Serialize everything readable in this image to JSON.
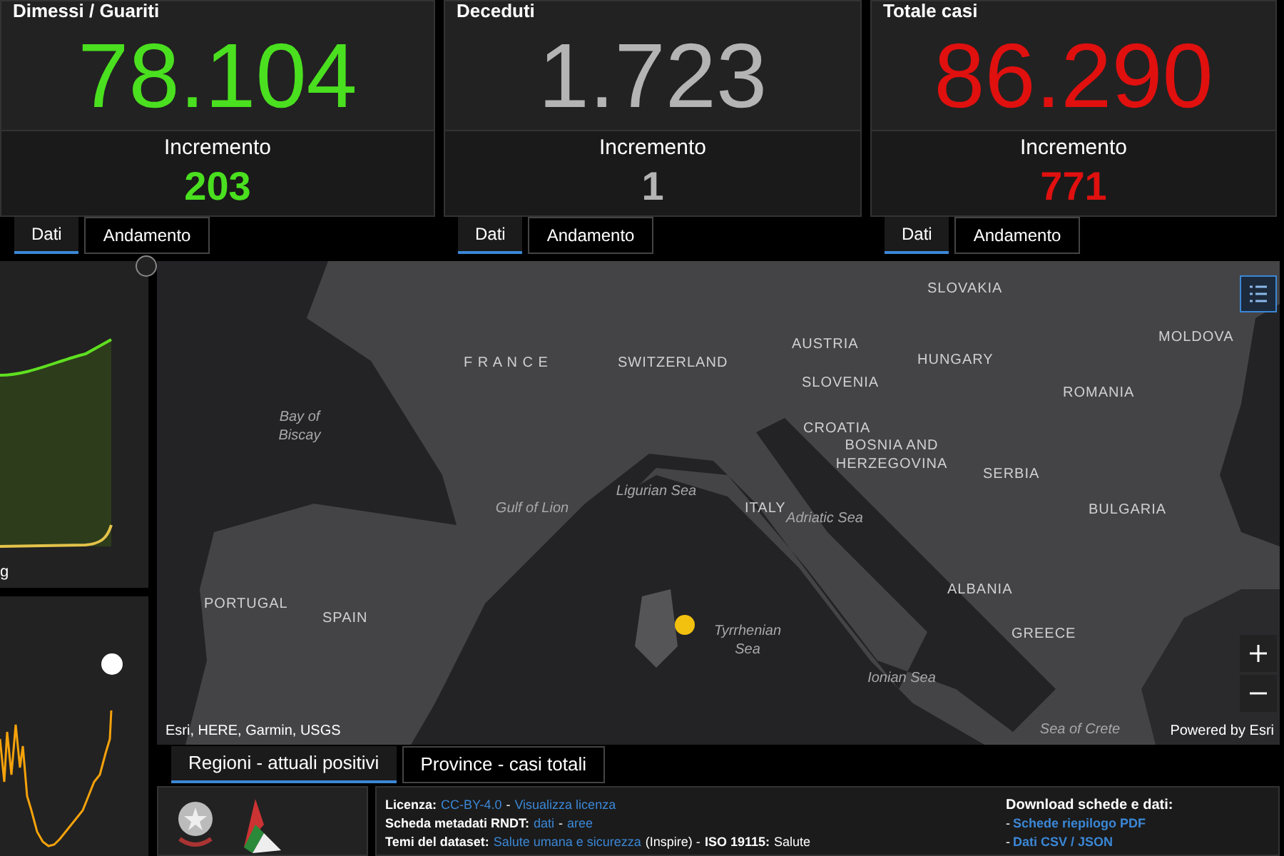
{
  "stats": [
    {
      "title": "Dimessi / Guariti",
      "value": "78.104",
      "increment_label": "Incremento",
      "increment": "203",
      "color": "#4ae01f",
      "tabs": [
        {
          "label": "Dati",
          "selected": true
        },
        {
          "label": "Andamento",
          "selected": false
        }
      ]
    },
    {
      "title": "Deceduti",
      "value": "1.723",
      "increment_label": "Incremento",
      "increment": "1",
      "color": "#b4b4b4",
      "tabs": [
        {
          "label": "Dati",
          "selected": true
        },
        {
          "label": "Andamento",
          "selected": false
        }
      ]
    },
    {
      "title": "Totale casi",
      "value": "86.290",
      "increment_label": "Incremento",
      "increment": "771",
      "color": "#e0100f",
      "tabs": [
        {
          "label": "Dati",
          "selected": true
        },
        {
          "label": "Andamento",
          "selected": false
        }
      ]
    }
  ],
  "trend_panel": {
    "axis_label": "g"
  },
  "map": {
    "labels": [
      {
        "text": "SLOVAKIA",
        "kind": "country"
      },
      {
        "text": "MOLDOVA",
        "kind": "country"
      },
      {
        "text": "F R A N C E",
        "kind": "country"
      },
      {
        "text": "SWITZERLAND",
        "kind": "country"
      },
      {
        "text": "AUSTRIA",
        "kind": "country"
      },
      {
        "text": "HUNGARY",
        "kind": "country"
      },
      {
        "text": "SLOVENIA",
        "kind": "country"
      },
      {
        "text": "ROMANIA",
        "kind": "country"
      },
      {
        "text": "Bay of Biscay",
        "kind": "sea"
      },
      {
        "text": "CROATIA",
        "kind": "country"
      },
      {
        "text": "BOSNIA AND HERZEGOVINA",
        "kind": "country"
      },
      {
        "text": "SERBIA",
        "kind": "country"
      },
      {
        "text": "Ligurian Sea",
        "kind": "sea"
      },
      {
        "text": "Gulf of Lion",
        "kind": "sea"
      },
      {
        "text": "ITALY",
        "kind": "country"
      },
      {
        "text": "Adriatic Sea",
        "kind": "sea"
      },
      {
        "text": "BULGARIA",
        "kind": "country"
      },
      {
        "text": "ALBANIA",
        "kind": "country"
      },
      {
        "text": "PORTUGAL",
        "kind": "country"
      },
      {
        "text": "SPAIN",
        "kind": "country"
      },
      {
        "text": "Tyrrhenian Sea",
        "kind": "sea"
      },
      {
        "text": "GREECE",
        "kind": "country"
      },
      {
        "text": "Ionian Sea",
        "kind": "sea"
      },
      {
        "text": "Sea of Crete",
        "kind": "sea"
      }
    ],
    "marker": {
      "color": "#f2c10f"
    },
    "attribution": "Esri, HERE, Garmin, USGS",
    "powered_by": "Powered by Esri"
  },
  "bottom_tabs": [
    {
      "label": "Regioni - attuali positivi",
      "selected": true
    },
    {
      "label": "Province - casi totali",
      "selected": false
    }
  ],
  "footer": {
    "lines": [
      [
        {
          "kind": "label",
          "text": "Licenza:"
        },
        {
          "kind": "link",
          "text": "CC-BY-4.0"
        },
        {
          "kind": "text",
          "text": "-"
        },
        {
          "kind": "link",
          "text": "Visualizza licenza"
        }
      ],
      [
        {
          "kind": "label",
          "text": "Scheda metadati RNDT:"
        },
        {
          "kind": "link",
          "text": "dati"
        },
        {
          "kind": "text",
          "text": "-"
        },
        {
          "kind": "link",
          "text": "aree"
        }
      ],
      [
        {
          "kind": "label",
          "text": "Temi del dataset:"
        },
        {
          "kind": "link",
          "text": "Salute umana e sicurezza"
        },
        {
          "kind": "text",
          "text": "(Inspire) -"
        },
        {
          "kind": "label",
          "text": "ISO 19115:"
        },
        {
          "kind": "text",
          "text": "Salute"
        }
      ]
    ],
    "download_title": "Download schede e dati:",
    "downloads": [
      {
        "prefix": "-",
        "text": "Schede riepilogo PDF"
      },
      {
        "prefix": "-",
        "text": "Dati CSV / JSON"
      }
    ]
  }
}
